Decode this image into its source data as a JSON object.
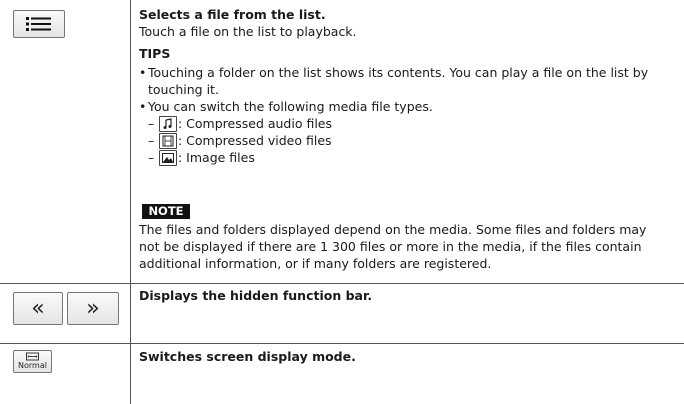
{
  "row1": {
    "title": "Selects a file from the list.",
    "desc": "Touch a file on the list to playback.",
    "tips_heading": "TIPS",
    "tip1_line1": "Touching a folder on the list shows its contents. You can play a file on the list by",
    "tip1_line2": "touching it.",
    "tip2": "You can switch the following media file types.",
    "types": [
      {
        "icon": "music-note-icon",
        "label": ": Compressed audio files"
      },
      {
        "icon": "film-icon",
        "label": ": Compressed video files"
      },
      {
        "icon": "image-icon",
        "label": ": Image files"
      }
    ],
    "note_label": "NOTE",
    "note_lines": [
      "The files and folders displayed depend on the media. Some files and folders may",
      "not be displayed if there are 1 300 files or more in the media, if the files contain",
      "additional information, or if many folders are registered."
    ]
  },
  "row2": {
    "title": "Displays the hidden function bar.",
    "left_btn": "«",
    "right_btn": "»"
  },
  "row3": {
    "title": "Switches screen display mode.",
    "button_label": "Normal"
  },
  "bullet": "•",
  "dash": "–"
}
